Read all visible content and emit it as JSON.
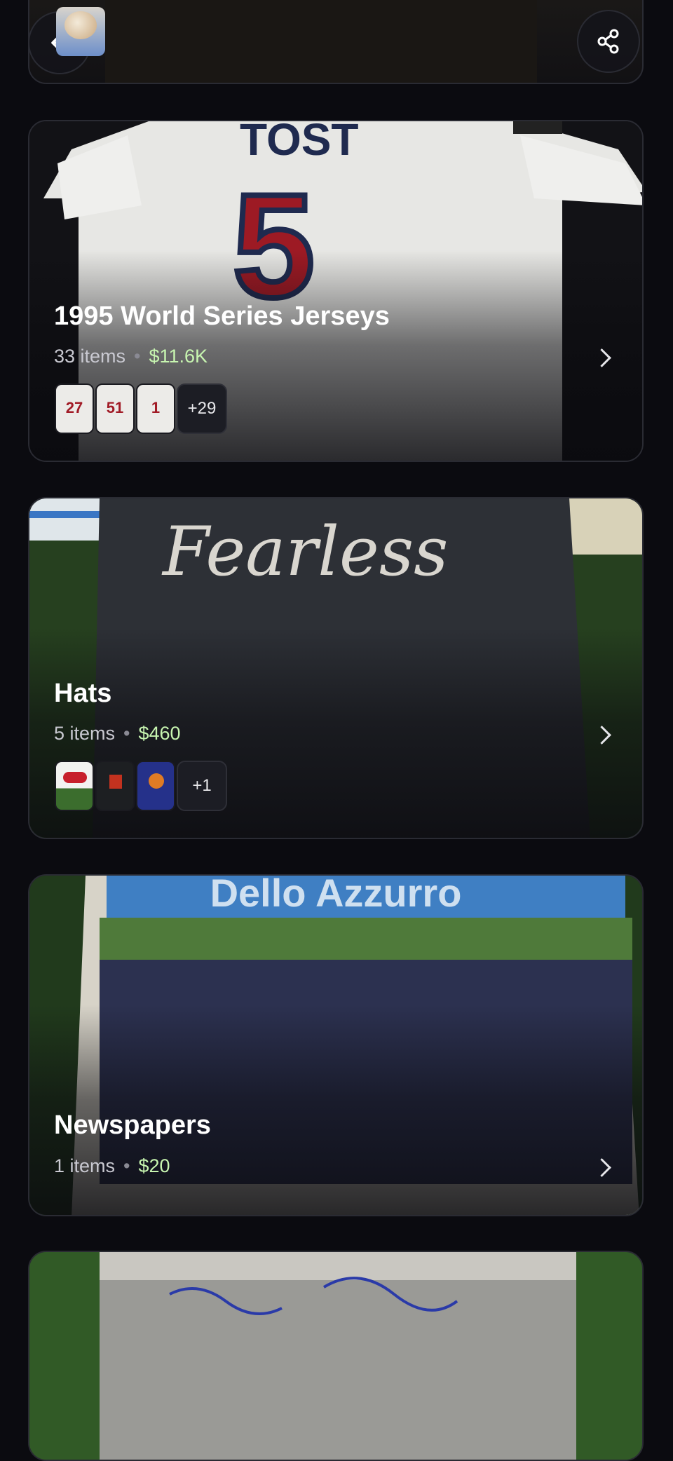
{
  "nav": {
    "back_label": "Back",
    "share_label": "Share"
  },
  "collections": [
    {
      "title": "1995 World Series Jerseys",
      "count": "33 items",
      "value": "$11.6K",
      "more": "+29",
      "thumbs": [
        {
          "number": "27"
        },
        {
          "number": "51"
        },
        {
          "number": "1"
        }
      ]
    },
    {
      "title": "Hats",
      "count": "5 items",
      "value": "$460",
      "more": "+1",
      "thumbs": [
        {
          "number": ""
        },
        {
          "number": ""
        },
        {
          "number": ""
        }
      ],
      "hero_text": "Fearless"
    },
    {
      "title": "Newspapers",
      "count": "1 items",
      "value": "$20",
      "hero_text": "Dello Azzurro"
    }
  ],
  "colors": {
    "background": "#0b0b10",
    "value_green": "#c7f5b0",
    "card_border": "#2a2b33"
  },
  "icons": [
    "back-arrow-icon",
    "share-icon",
    "chevron-right-icon"
  ]
}
